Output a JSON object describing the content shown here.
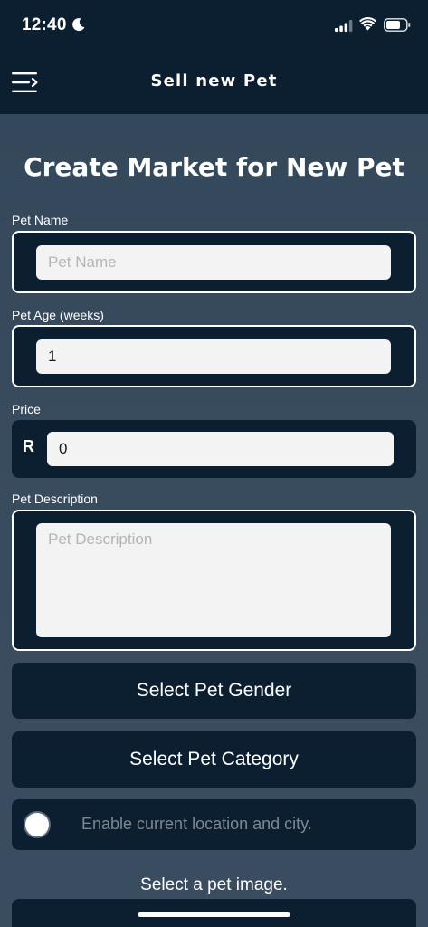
{
  "status_bar": {
    "time": "12:40"
  },
  "header": {
    "title": "Sell new Pet"
  },
  "page": {
    "title": "Create Market for New Pet"
  },
  "form": {
    "pet_name": {
      "label": "Pet Name",
      "value": "",
      "placeholder": "Pet Name"
    },
    "pet_age": {
      "label": "Pet Age (weeks)",
      "value": "1",
      "placeholder": ""
    },
    "price": {
      "label": "Price",
      "currency": "R",
      "value": "0"
    },
    "description": {
      "label": "Pet Description",
      "value": "",
      "placeholder": "Pet Description"
    },
    "gender_button": "Select Pet Gender",
    "category_button": "Select Pet Category",
    "location_toggle": {
      "label": "Enable current location and city.",
      "enabled": false
    },
    "image_prompt": "Select a pet image."
  },
  "colors": {
    "primary_dark": "#0b1f30",
    "background": "#394c5e",
    "input_bg": "#f3f3f3",
    "placeholder": "#b5b5b5"
  },
  "icons": [
    "moon-icon",
    "signal-icon",
    "wifi-icon",
    "battery-icon",
    "menu-icon"
  ]
}
